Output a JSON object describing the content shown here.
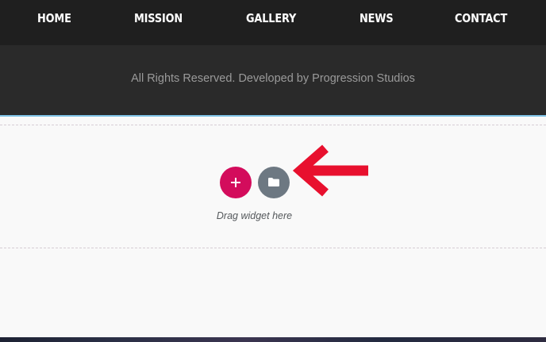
{
  "nav": {
    "items": [
      {
        "label": "HOME"
      },
      {
        "label": "MISSION"
      },
      {
        "label": "GALLERY"
      },
      {
        "label": "NEWS"
      },
      {
        "label": "CONTACT"
      }
    ]
  },
  "footer": {
    "copyright": "All Rights Reserved. Developed by Progression Studios"
  },
  "dropzone": {
    "add_button_icon": "plus-icon",
    "template_button_icon": "folder-icon",
    "hint": "Drag widget here",
    "add_button_color": "#d30c5c",
    "template_button_color": "#6d7882"
  },
  "annotation": {
    "arrow_color": "#e8102e",
    "arrow_icon": "arrow-left-icon"
  }
}
